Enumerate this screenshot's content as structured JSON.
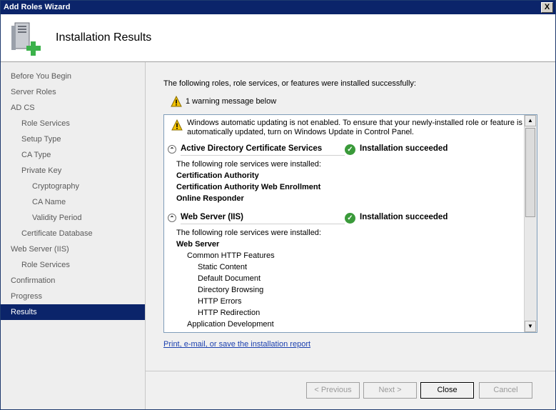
{
  "window": {
    "title": "Add Roles Wizard",
    "close_label": "X"
  },
  "header": {
    "title": "Installation Results"
  },
  "sidebar": {
    "items": [
      {
        "label": "Before You Begin",
        "level": 0
      },
      {
        "label": "Server Roles",
        "level": 0
      },
      {
        "label": "AD CS",
        "level": 0
      },
      {
        "label": "Role Services",
        "level": 1
      },
      {
        "label": "Setup Type",
        "level": 1
      },
      {
        "label": "CA Type",
        "level": 1
      },
      {
        "label": "Private Key",
        "level": 1
      },
      {
        "label": "Cryptography",
        "level": 2
      },
      {
        "label": "CA Name",
        "level": 2
      },
      {
        "label": "Validity Period",
        "level": 2
      },
      {
        "label": "Certificate Database",
        "level": 1
      },
      {
        "label": "Web Server (IIS)",
        "level": 0
      },
      {
        "label": "Role Services",
        "level": 1
      },
      {
        "label": "Confirmation",
        "level": 0
      },
      {
        "label": "Progress",
        "level": 0
      },
      {
        "label": "Results",
        "level": 0,
        "selected": true
      }
    ]
  },
  "main": {
    "intro": "The following roles, role services, or features were installed successfully:",
    "warning_summary": "1 warning message below",
    "panel": {
      "warning_line1": "Windows automatic updating is not enabled. To ensure that your newly-installed role or feature is",
      "warning_line2": "automatically updated, turn on Windows Update in Control Panel.",
      "sections": [
        {
          "name": "Active Directory Certificate Services",
          "status": "Installation succeeded",
          "intro": "The following role services were installed:",
          "items": [
            "Certification Authority",
            "Certification Authority Web Enrollment",
            "Online Responder"
          ]
        },
        {
          "name": "Web Server (IIS)",
          "status": "Installation succeeded",
          "intro": "The following role services were installed:",
          "group": "Web Server",
          "subgroup": "Common HTTP Features",
          "features": [
            "Static Content",
            "Default Document",
            "Directory Browsing",
            "HTTP Errors",
            "HTTP Redirection"
          ],
          "subgroup2": "Application Development"
        }
      ]
    },
    "report_link": "Print, e-mail, or save the installation report"
  },
  "footer": {
    "previous": "< Previous",
    "next": "Next >",
    "close": "Close",
    "cancel": "Cancel"
  },
  "colors": {
    "selection": "#0b246a",
    "link": "#1a3fae",
    "success": "#3a9a3a",
    "warning": "#f2c200"
  }
}
